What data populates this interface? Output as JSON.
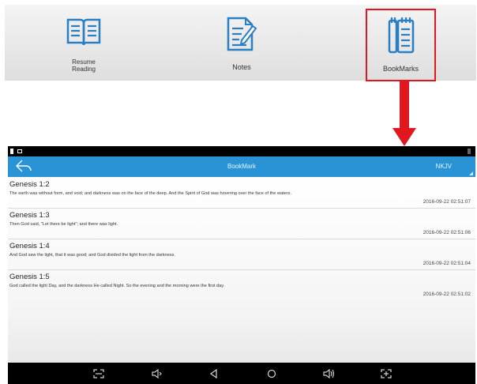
{
  "top_menu": {
    "resume_label": "Resume\nReading",
    "notes_label": "Notes",
    "bookmarks_label": "BookMarks"
  },
  "app": {
    "title": "BookMark",
    "version": "NKJV"
  },
  "bookmarks": [
    {
      "ref": "Genesis 1:2",
      "text": "The earth was without form, and void; and darkness was on the face of the deep. And the Spirit of God was hovering over the face of the waters.",
      "date": "2016-09-22 02:51:07"
    },
    {
      "ref": "Genesis 1:3",
      "text": "Then God said, \"Let there be light\"; and there was light.",
      "date": "2016-09-22 02:51:06"
    },
    {
      "ref": "Genesis 1:4",
      "text": "And God saw the light, that it was good; and God divided the light from the darkness.",
      "date": "2016-09-22 02:51:04"
    },
    {
      "ref": "Genesis 1:5",
      "text": "God called the light Day, and the darkness He called Night. So the evening and the morning were the first day.",
      "date": "2016-09-22 02:51:02"
    }
  ],
  "colors": {
    "accent": "#2a93d5",
    "highlight": "#e0171f"
  }
}
